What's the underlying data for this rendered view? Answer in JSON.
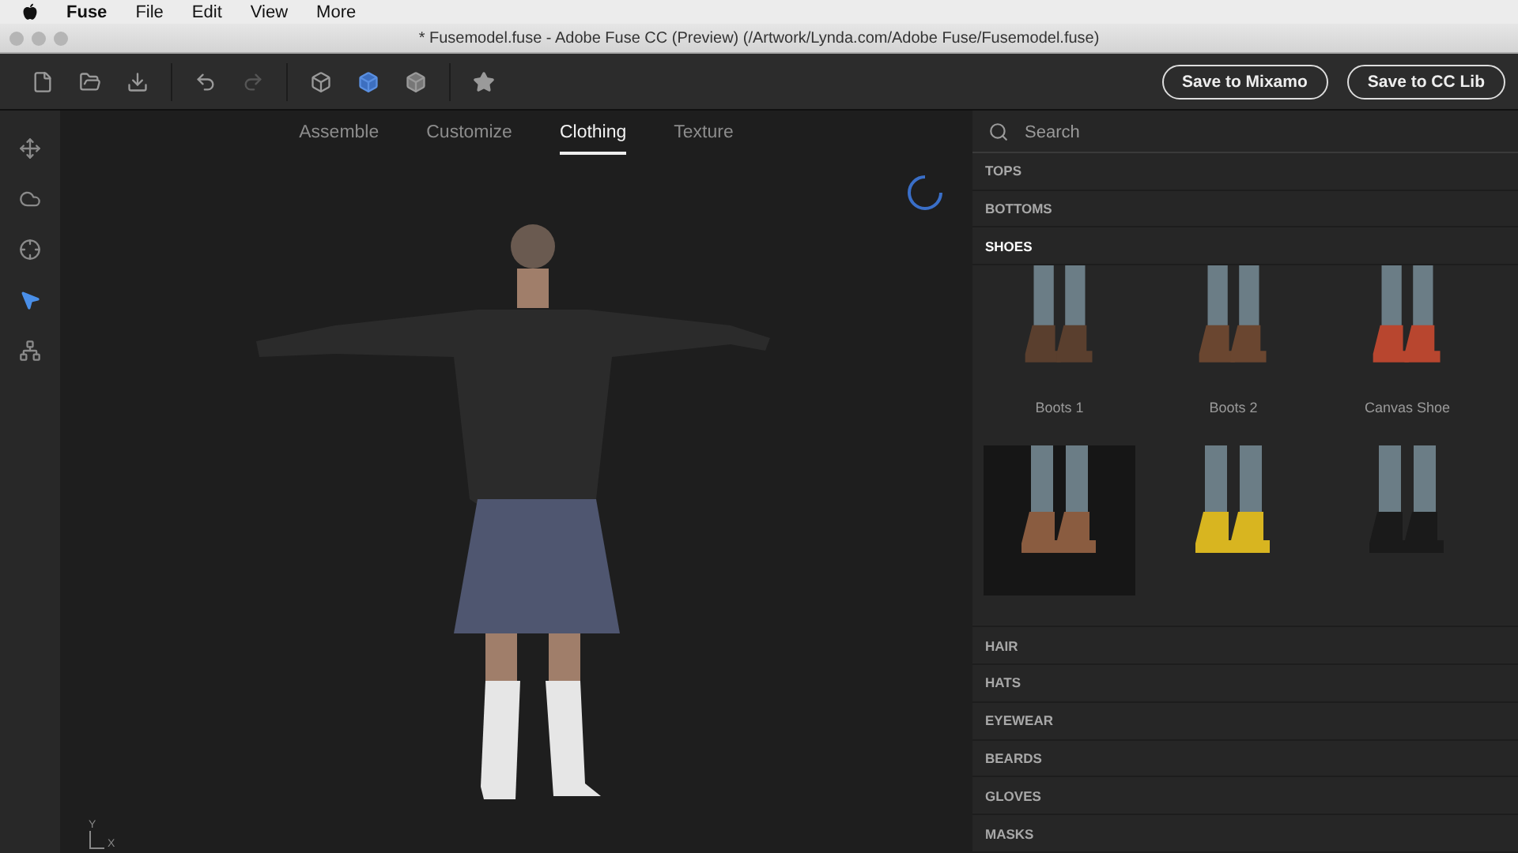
{
  "menu_bar": {
    "app": "Fuse",
    "items": [
      "File",
      "Edit",
      "View",
      "More"
    ]
  },
  "window": {
    "title": "* Fusemodel.fuse - Adobe Fuse CC (Preview) (/Artwork/Lynda.com/Adobe Fuse/Fusemodel.fuse)"
  },
  "toolbar": {
    "buttons": [
      "Save to Mixamo",
      "Save to CC Lib"
    ]
  },
  "tools": [
    {
      "kind": "move",
      "selected": false
    },
    {
      "kind": "orbit",
      "selected": false
    },
    {
      "kind": "target",
      "selected": false
    },
    {
      "kind": "select",
      "selected": true
    },
    {
      "kind": "pose",
      "selected": false
    }
  ],
  "tabs": [
    {
      "label": "Assemble",
      "selected": false
    },
    {
      "label": "Customize",
      "selected": false
    },
    {
      "label": "Clothing",
      "selected": true
    },
    {
      "label": "Texture",
      "selected": false
    }
  ],
  "axis": {
    "y": "Y",
    "x": "X"
  },
  "search": {
    "placeholder": "Search"
  },
  "categories": [
    {
      "label": "TOPS",
      "expanded": false
    },
    {
      "label": "BOTTOMS",
      "expanded": false
    },
    {
      "label": "SHOES",
      "expanded": true,
      "items": [
        {
          "label": "Boots 1",
          "selected": false,
          "color": "#5a3f2e"
        },
        {
          "label": "Boots 2",
          "selected": false,
          "color": "#6a4630"
        },
        {
          "label": "Canvas Shoe",
          "selected": false,
          "color": "#b8462f"
        },
        {
          "selected": true,
          "color": "#8a5c40"
        },
        {
          "selected": false,
          "color": "#d8b520"
        },
        {
          "selected": false,
          "color": "#1a1a1a"
        }
      ]
    },
    {
      "label": "HAIR",
      "expanded": false
    },
    {
      "label": "HATS",
      "expanded": false
    },
    {
      "label": "EYEWEAR",
      "expanded": false
    },
    {
      "label": "BEARDS",
      "expanded": false
    },
    {
      "label": "GLOVES",
      "expanded": false
    },
    {
      "label": "MASKS",
      "expanded": false
    }
  ]
}
